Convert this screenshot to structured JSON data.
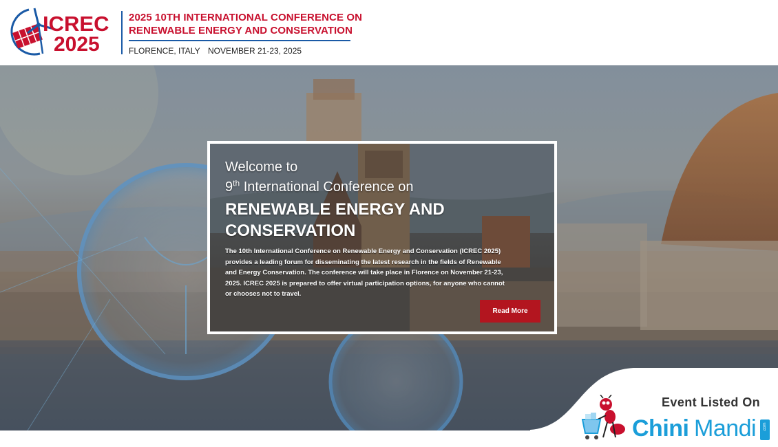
{
  "header": {
    "logo_line1": "ICREC",
    "logo_line2": "2025",
    "title_line1": "2025 10TH INTERNATIONAL CONFERENCE ON",
    "title_line2": "RENEWABLE ENERGY AND CONSERVATION",
    "location": "FLORENCE, ITALY",
    "dates": "NOVEMBER 21-23, 2025"
  },
  "card": {
    "welcome_line1": "Welcome to",
    "ordinal_number": "9",
    "ordinal_suffix": "th",
    "welcome_line2_rest": " International Conference on",
    "headline_line1": "RENEWABLE ENERGY AND",
    "headline_line2": "CONSERVATION",
    "description_line1": "The 10th International Conference on Renewable Energy and Conservation (ICREC 2025)",
    "description_line2": "provides a leading forum for disseminating the latest research in the fields of Renewable",
    "description_line3": "and Energy Conservation. The conference will take place in Florence on November 21-23,",
    "description_line4": "2025. ICREC 2025 is prepared to offer virtual participation options, for anyone who cannot",
    "description_line5": "or chooses not to travel.",
    "read_more_label": "Read More"
  },
  "listing": {
    "label": "Event Listed On",
    "brand_part1": "Chini",
    "brand_part2": "Mandi",
    "brand_suffix": ".com"
  },
  "colors": {
    "brand_red": "#c8102e",
    "brand_blue": "#1a5aa6",
    "button_red": "#b3151f",
    "chinimandi_blue": "#1b9ed9"
  }
}
